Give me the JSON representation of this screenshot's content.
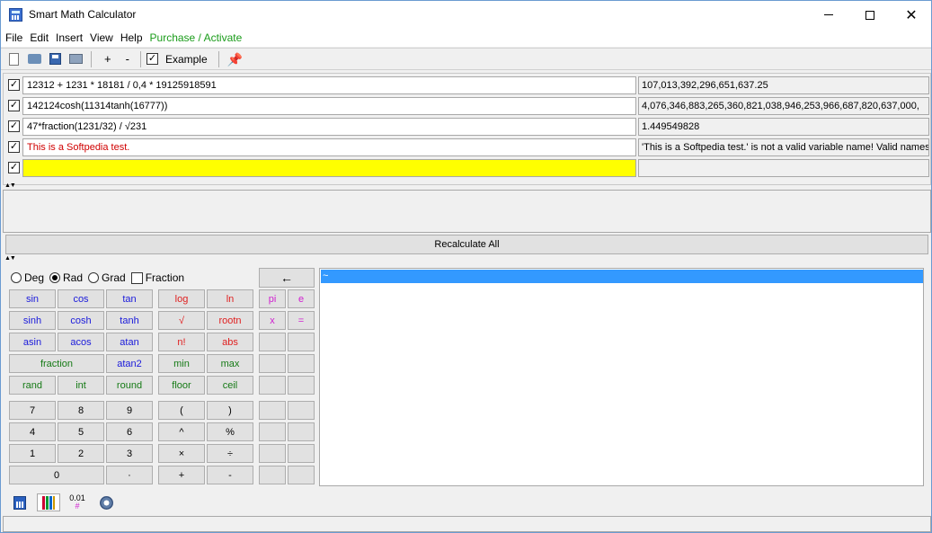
{
  "window": {
    "title": "Smart Math Calculator",
    "minimize_label": "",
    "maximize_label": "",
    "close_label": "✕"
  },
  "menu": {
    "file": "File",
    "edit": "Edit",
    "insert": "Insert",
    "view": "View",
    "help": "Help",
    "purchase": "Purchase / Activate"
  },
  "toolbar": {
    "plus": "+",
    "minus": "-",
    "example_checked": true,
    "example_label": "Example"
  },
  "expressions": [
    {
      "checked": true,
      "input": "12312 + 1231 * 18181 / 0,4 * 19125918591",
      "result": "107,013,392,296,651,637.25",
      "style": "normal"
    },
    {
      "checked": true,
      "input": "142124cosh(11314tanh(16777))",
      "result": "4,076,346,883,265,360,821,038,946,253,966,687,820,637,000,",
      "style": "normal"
    },
    {
      "checked": true,
      "input": "47*fraction(1231/32) / √231",
      "result": "1.449549828",
      "style": "normal"
    },
    {
      "checked": true,
      "input": "This is a Softpedia test.",
      "result": "'This is a Softpedia test.' is not a valid variable name! Valid names s",
      "style": "red"
    },
    {
      "checked": true,
      "input": "",
      "result": "",
      "style": "yellow"
    }
  ],
  "recalculate_label": "Recalculate All",
  "modes": {
    "deg": "Deg",
    "rad": "Rad",
    "grad": "Grad",
    "fraction": "Fraction",
    "selected": "rad"
  },
  "backspace_label": "←",
  "keys": {
    "sin": "sin",
    "cos": "cos",
    "tan": "tan",
    "log": "log",
    "ln": "ln",
    "sinh": "sinh",
    "cosh": "cosh",
    "tanh": "tanh",
    "sqrt": "√",
    "rootn": "rootn",
    "asin": "asin",
    "acos": "acos",
    "atan": "atan",
    "fact": "n!",
    "abs": "abs",
    "fraction": "fraction",
    "atan2": "atan2",
    "min": "min",
    "max": "max",
    "rand": "rand",
    "int": "int",
    "round": "round",
    "floor": "floor",
    "ceil": "ceil",
    "pi": "pi",
    "e": "e",
    "x": "x",
    "eq": "=",
    "n7": "7",
    "n8": "8",
    "n9": "9",
    "lparen": "(",
    "rparen": ")",
    "n4": "4",
    "n5": "5",
    "n6": "6",
    "pow": "^",
    "pct": "%",
    "n1": "1",
    "n2": "2",
    "n3": "3",
    "mul": "×",
    "div": "÷",
    "n0": "0",
    "dot": "·",
    "add": "+",
    "sub": "-"
  },
  "output": {
    "selected_line": "~"
  },
  "bottom_tabs": {
    "num_top": "0.01",
    "num_bottom": "#"
  }
}
